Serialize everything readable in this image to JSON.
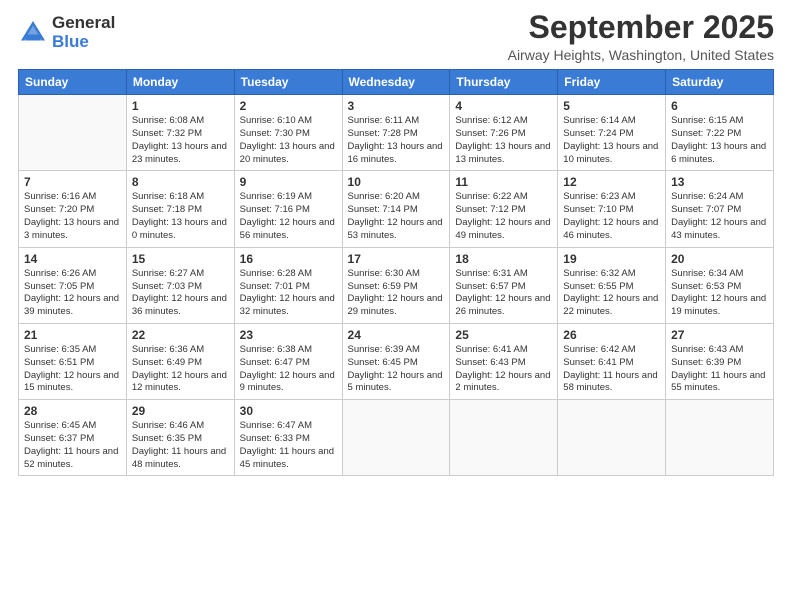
{
  "logo": {
    "general": "General",
    "blue": "Blue"
  },
  "title": "September 2025",
  "location": "Airway Heights, Washington, United States",
  "days_of_week": [
    "Sunday",
    "Monday",
    "Tuesday",
    "Wednesday",
    "Thursday",
    "Friday",
    "Saturday"
  ],
  "weeks": [
    [
      {
        "day": "",
        "sunrise": "",
        "sunset": "",
        "daylight": ""
      },
      {
        "day": "1",
        "sunrise": "Sunrise: 6:08 AM",
        "sunset": "Sunset: 7:32 PM",
        "daylight": "Daylight: 13 hours and 23 minutes."
      },
      {
        "day": "2",
        "sunrise": "Sunrise: 6:10 AM",
        "sunset": "Sunset: 7:30 PM",
        "daylight": "Daylight: 13 hours and 20 minutes."
      },
      {
        "day": "3",
        "sunrise": "Sunrise: 6:11 AM",
        "sunset": "Sunset: 7:28 PM",
        "daylight": "Daylight: 13 hours and 16 minutes."
      },
      {
        "day": "4",
        "sunrise": "Sunrise: 6:12 AM",
        "sunset": "Sunset: 7:26 PM",
        "daylight": "Daylight: 13 hours and 13 minutes."
      },
      {
        "day": "5",
        "sunrise": "Sunrise: 6:14 AM",
        "sunset": "Sunset: 7:24 PM",
        "daylight": "Daylight: 13 hours and 10 minutes."
      },
      {
        "day": "6",
        "sunrise": "Sunrise: 6:15 AM",
        "sunset": "Sunset: 7:22 PM",
        "daylight": "Daylight: 13 hours and 6 minutes."
      }
    ],
    [
      {
        "day": "7",
        "sunrise": "Sunrise: 6:16 AM",
        "sunset": "Sunset: 7:20 PM",
        "daylight": "Daylight: 13 hours and 3 minutes."
      },
      {
        "day": "8",
        "sunrise": "Sunrise: 6:18 AM",
        "sunset": "Sunset: 7:18 PM",
        "daylight": "Daylight: 13 hours and 0 minutes."
      },
      {
        "day": "9",
        "sunrise": "Sunrise: 6:19 AM",
        "sunset": "Sunset: 7:16 PM",
        "daylight": "Daylight: 12 hours and 56 minutes."
      },
      {
        "day": "10",
        "sunrise": "Sunrise: 6:20 AM",
        "sunset": "Sunset: 7:14 PM",
        "daylight": "Daylight: 12 hours and 53 minutes."
      },
      {
        "day": "11",
        "sunrise": "Sunrise: 6:22 AM",
        "sunset": "Sunset: 7:12 PM",
        "daylight": "Daylight: 12 hours and 49 minutes."
      },
      {
        "day": "12",
        "sunrise": "Sunrise: 6:23 AM",
        "sunset": "Sunset: 7:10 PM",
        "daylight": "Daylight: 12 hours and 46 minutes."
      },
      {
        "day": "13",
        "sunrise": "Sunrise: 6:24 AM",
        "sunset": "Sunset: 7:07 PM",
        "daylight": "Daylight: 12 hours and 43 minutes."
      }
    ],
    [
      {
        "day": "14",
        "sunrise": "Sunrise: 6:26 AM",
        "sunset": "Sunset: 7:05 PM",
        "daylight": "Daylight: 12 hours and 39 minutes."
      },
      {
        "day": "15",
        "sunrise": "Sunrise: 6:27 AM",
        "sunset": "Sunset: 7:03 PM",
        "daylight": "Daylight: 12 hours and 36 minutes."
      },
      {
        "day": "16",
        "sunrise": "Sunrise: 6:28 AM",
        "sunset": "Sunset: 7:01 PM",
        "daylight": "Daylight: 12 hours and 32 minutes."
      },
      {
        "day": "17",
        "sunrise": "Sunrise: 6:30 AM",
        "sunset": "Sunset: 6:59 PM",
        "daylight": "Daylight: 12 hours and 29 minutes."
      },
      {
        "day": "18",
        "sunrise": "Sunrise: 6:31 AM",
        "sunset": "Sunset: 6:57 PM",
        "daylight": "Daylight: 12 hours and 26 minutes."
      },
      {
        "day": "19",
        "sunrise": "Sunrise: 6:32 AM",
        "sunset": "Sunset: 6:55 PM",
        "daylight": "Daylight: 12 hours and 22 minutes."
      },
      {
        "day": "20",
        "sunrise": "Sunrise: 6:34 AM",
        "sunset": "Sunset: 6:53 PM",
        "daylight": "Daylight: 12 hours and 19 minutes."
      }
    ],
    [
      {
        "day": "21",
        "sunrise": "Sunrise: 6:35 AM",
        "sunset": "Sunset: 6:51 PM",
        "daylight": "Daylight: 12 hours and 15 minutes."
      },
      {
        "day": "22",
        "sunrise": "Sunrise: 6:36 AM",
        "sunset": "Sunset: 6:49 PM",
        "daylight": "Daylight: 12 hours and 12 minutes."
      },
      {
        "day": "23",
        "sunrise": "Sunrise: 6:38 AM",
        "sunset": "Sunset: 6:47 PM",
        "daylight": "Daylight: 12 hours and 9 minutes."
      },
      {
        "day": "24",
        "sunrise": "Sunrise: 6:39 AM",
        "sunset": "Sunset: 6:45 PM",
        "daylight": "Daylight: 12 hours and 5 minutes."
      },
      {
        "day": "25",
        "sunrise": "Sunrise: 6:41 AM",
        "sunset": "Sunset: 6:43 PM",
        "daylight": "Daylight: 12 hours and 2 minutes."
      },
      {
        "day": "26",
        "sunrise": "Sunrise: 6:42 AM",
        "sunset": "Sunset: 6:41 PM",
        "daylight": "Daylight: 11 hours and 58 minutes."
      },
      {
        "day": "27",
        "sunrise": "Sunrise: 6:43 AM",
        "sunset": "Sunset: 6:39 PM",
        "daylight": "Daylight: 11 hours and 55 minutes."
      }
    ],
    [
      {
        "day": "28",
        "sunrise": "Sunrise: 6:45 AM",
        "sunset": "Sunset: 6:37 PM",
        "daylight": "Daylight: 11 hours and 52 minutes."
      },
      {
        "day": "29",
        "sunrise": "Sunrise: 6:46 AM",
        "sunset": "Sunset: 6:35 PM",
        "daylight": "Daylight: 11 hours and 48 minutes."
      },
      {
        "day": "30",
        "sunrise": "Sunrise: 6:47 AM",
        "sunset": "Sunset: 6:33 PM",
        "daylight": "Daylight: 11 hours and 45 minutes."
      },
      {
        "day": "",
        "sunrise": "",
        "sunset": "",
        "daylight": ""
      },
      {
        "day": "",
        "sunrise": "",
        "sunset": "",
        "daylight": ""
      },
      {
        "day": "",
        "sunrise": "",
        "sunset": "",
        "daylight": ""
      },
      {
        "day": "",
        "sunrise": "",
        "sunset": "",
        "daylight": ""
      }
    ]
  ]
}
